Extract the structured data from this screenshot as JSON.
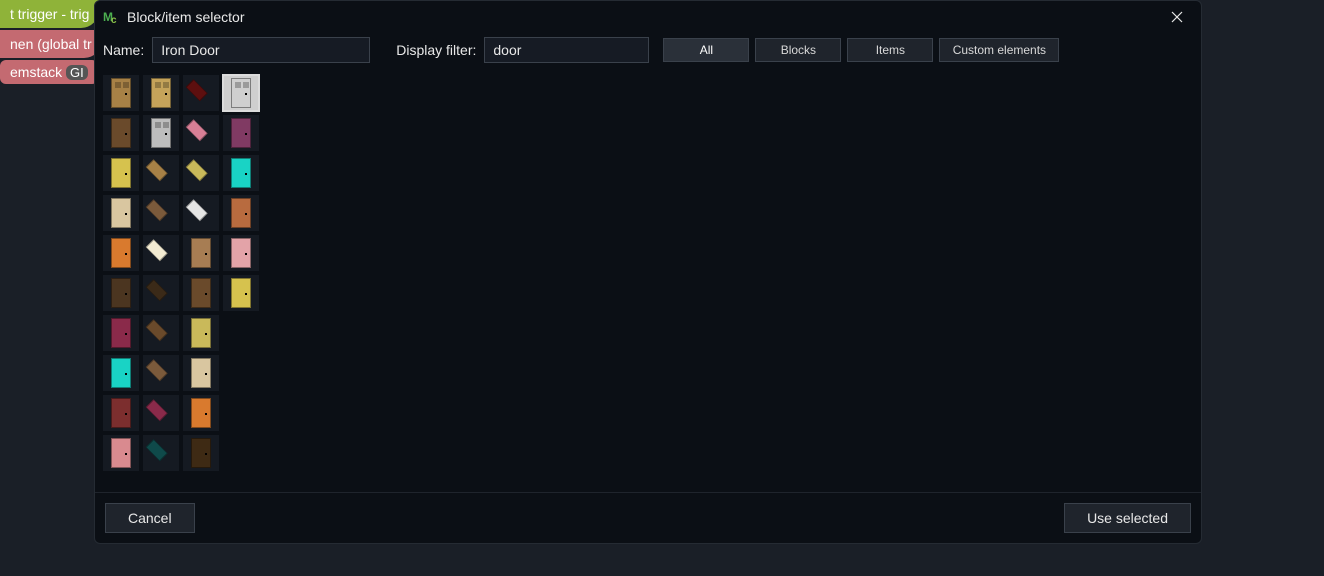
{
  "bg": {
    "green": "t trigger - trig",
    "pink": "nen (global tr",
    "pink2_pre": "emstack",
    "pink2_pill": "GI"
  },
  "dialog": {
    "title": "Block/item selector",
    "name_label": "Name:",
    "name_value": "Iron Door",
    "filter_label": "Display filter:",
    "filter_value": "door",
    "buttons": {
      "all": "All",
      "blocks": "Blocks",
      "items": "Items",
      "custom": "Custom elements"
    },
    "active_filter": "all",
    "footer": {
      "cancel": "Cancel",
      "use": "Use selected"
    }
  },
  "items": [
    {
      "id": "oak-door",
      "type": "door",
      "color": "c-oak",
      "panel": true,
      "row": 0,
      "col": 0
    },
    {
      "id": "oak-door-lit",
      "type": "door",
      "color": "c-oaklit",
      "panel": true,
      "row": 0,
      "col": 1
    },
    {
      "id": "crimson-trapdoor",
      "type": "trap",
      "color": "c-darkred",
      "row": 0,
      "col": 2
    },
    {
      "id": "iron-door",
      "type": "door",
      "color": "c-iron",
      "panel": true,
      "row": 0,
      "col": 3,
      "selected": true
    },
    {
      "id": "spruce-door",
      "type": "door",
      "color": "c-spruce",
      "row": 1,
      "col": 0
    },
    {
      "id": "iron-door-2",
      "type": "door",
      "color": "c-irondk",
      "panel": true,
      "row": 1,
      "col": 1
    },
    {
      "id": "pink-trapdoor",
      "type": "trap",
      "color": "c-pink",
      "row": 1,
      "col": 2
    },
    {
      "id": "warped-door",
      "type": "door",
      "color": "c-warped",
      "row": 1,
      "col": 3
    },
    {
      "id": "yellow-door",
      "type": "door",
      "color": "c-yellow",
      "row": 2,
      "col": 0
    },
    {
      "id": "oak-trapdoor",
      "type": "trap",
      "color": "c-oak",
      "row": 2,
      "col": 1
    },
    {
      "id": "bamboo-trapdoor",
      "type": "trap",
      "color": "c-bamboo",
      "row": 2,
      "col": 2
    },
    {
      "id": "teal-door",
      "type": "door",
      "color": "c-teal",
      "row": 2,
      "col": 3
    },
    {
      "id": "birch-item",
      "type": "door",
      "color": "c-birch",
      "row": 3,
      "col": 0
    },
    {
      "id": "brown-trapdoor",
      "type": "trap",
      "color": "c-brown",
      "row": 3,
      "col": 1
    },
    {
      "id": "iron-trapdoor",
      "type": "trap",
      "color": "c-white",
      "row": 3,
      "col": 2
    },
    {
      "id": "acacia-door",
      "type": "door",
      "color": "c-acacia",
      "row": 3,
      "col": 3
    },
    {
      "id": "orange-door",
      "type": "door",
      "color": "c-orange",
      "row": 4,
      "col": 0
    },
    {
      "id": "birch-trapdoor",
      "type": "trap",
      "color": "c-cream",
      "row": 4,
      "col": 1
    },
    {
      "id": "jungle-door",
      "type": "door",
      "color": "c-jungle",
      "row": 4,
      "col": 2
    },
    {
      "id": "pink-check-door",
      "type": "door",
      "color": "c-pinkchk",
      "row": 4,
      "col": 3
    },
    {
      "id": "dark-door",
      "type": "door",
      "color": "c-dark",
      "row": 5,
      "col": 0
    },
    {
      "id": "dark-trapdoor",
      "type": "trap",
      "color": "c-darker",
      "row": 5,
      "col": 1
    },
    {
      "id": "spruce-door-2",
      "type": "door",
      "color": "c-spruce",
      "row": 5,
      "col": 2
    },
    {
      "id": "yellow-door-2",
      "type": "door",
      "color": "c-yellow",
      "row": 5,
      "col": 3
    },
    {
      "id": "crimson-door",
      "type": "door",
      "color": "c-crimson",
      "row": 6,
      "col": 0
    },
    {
      "id": "spruce-trapdoor",
      "type": "trap",
      "color": "c-spruce",
      "row": 6,
      "col": 1
    },
    {
      "id": "bamboo-door",
      "type": "door",
      "color": "c-bamboo",
      "row": 6,
      "col": 2
    },
    {
      "id": "teal-trapdoor-2",
      "type": "door",
      "color": "c-teal",
      "row": 7,
      "col": 0
    },
    {
      "id": "brown-trapdoor-2",
      "type": "trap",
      "color": "c-brown",
      "row": 7,
      "col": 1
    },
    {
      "id": "birch-door-2",
      "type": "door",
      "color": "c-birch",
      "row": 7,
      "col": 2
    },
    {
      "id": "mangrove-door",
      "type": "door",
      "color": "c-mangrove",
      "row": 8,
      "col": 0
    },
    {
      "id": "crimson-trapdoor-2",
      "type": "trap",
      "color": "c-crimson",
      "row": 8,
      "col": 1
    },
    {
      "id": "orange-door-2",
      "type": "door",
      "color": "c-orange",
      "row": 8,
      "col": 2
    },
    {
      "id": "cherry-door",
      "type": "door",
      "color": "c-cherry",
      "row": 9,
      "col": 0
    },
    {
      "id": "tealdk-trapdoor",
      "type": "trap",
      "color": "c-tealdk",
      "row": 9,
      "col": 1
    },
    {
      "id": "darkoak-door",
      "type": "door",
      "color": "c-darkoak",
      "row": 9,
      "col": 2
    }
  ]
}
